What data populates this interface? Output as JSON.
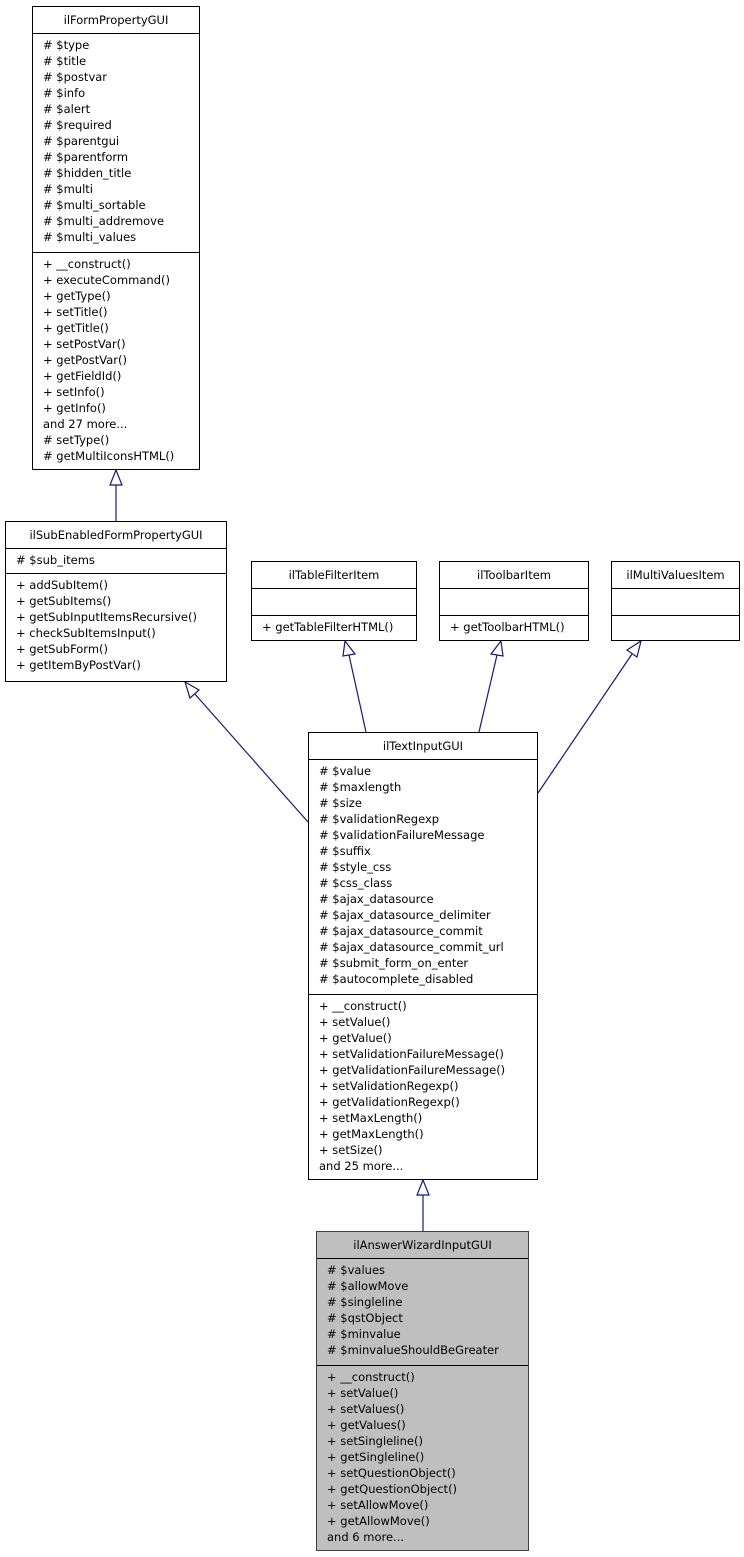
{
  "diagram": {
    "type": "uml-inheritance",
    "classes": {
      "formProperty": {
        "name": "ilFormPropertyGUI",
        "attributes": [
          "# $type",
          "# $title",
          "# $postvar",
          "# $info",
          "# $alert",
          "# $required",
          "# $parentgui",
          "# $parentform",
          "# $hidden_title",
          "# $multi",
          "# $multi_sortable",
          "# $multi_addremove",
          "# $multi_values"
        ],
        "methods": [
          "+ __construct()",
          "+ executeCommand()",
          "+ getType()",
          "+ setTitle()",
          "+ getTitle()",
          "+ setPostVar()",
          "+ getPostVar()",
          "+ getFieldId()",
          "+ setInfo()",
          "+ getInfo()",
          "and 27 more...",
          "# setType()",
          "# getMultiIconsHTML()"
        ]
      },
      "subEnabled": {
        "name": "ilSubEnabledFormPropertyGUI",
        "attributes": [
          "# $sub_items"
        ],
        "methods": [
          "+ addSubItem()",
          "+ getSubItems()",
          "+ getSubInputItemsRecursive()",
          "+ checkSubItemsInput()",
          "+ getSubForm()",
          "+ getItemByPostVar()"
        ]
      },
      "tableFilter": {
        "name": "ilTableFilterItem",
        "attributes": [],
        "methods": [
          "+ getTableFilterHTML()"
        ]
      },
      "toolbar": {
        "name": "ilToolbarItem",
        "attributes": [],
        "methods": [
          "+ getToolbarHTML()"
        ]
      },
      "multiValues": {
        "name": "ilMultiValuesItem",
        "attributes": [],
        "methods": []
      },
      "textInput": {
        "name": "ilTextInputGUI",
        "attributes": [
          "# $value",
          "# $maxlength",
          "# $size",
          "# $validationRegexp",
          "# $validationFailureMessage",
          "# $suffix",
          "# $style_css",
          "# $css_class",
          "# $ajax_datasource",
          "# $ajax_datasource_delimiter",
          "# $ajax_datasource_commit",
          "# $ajax_datasource_commit_url",
          "# $submit_form_on_enter",
          "# $autocomplete_disabled"
        ],
        "methods": [
          "+ __construct()",
          "+ setValue()",
          "+ getValue()",
          "+ setValidationFailureMessage()",
          "+ getValidationFailureMessage()",
          "+ setValidationRegexp()",
          "+ getValidationRegexp()",
          "+ setMaxLength()",
          "+ getMaxLength()",
          "+ setSize()",
          "and 25 more..."
        ]
      },
      "answerWizard": {
        "name": "ilAnswerWizardInputGUI",
        "attributes": [
          "# $values",
          "# $allowMove",
          "# $singleline",
          "# $qstObject",
          "# $minvalue",
          "# $minvalueShouldBeGreater"
        ],
        "methods": [
          "+ __construct()",
          "+ setValue()",
          "+ setValues()",
          "+ getValues()",
          "+ setSingleline()",
          "+ getSingleline()",
          "+ setQuestionObject()",
          "+ getQuestionObject()",
          "+ setAllowMove()",
          "+ getAllowMove()",
          "and 6 more..."
        ]
      }
    },
    "inheritance": [
      {
        "child": "ilSubEnabledFormPropertyGUI",
        "parent": "ilFormPropertyGUI"
      },
      {
        "child": "ilTextInputGUI",
        "parent": "ilSubEnabledFormPropertyGUI"
      },
      {
        "child": "ilTextInputGUI",
        "parent": "ilTableFilterItem"
      },
      {
        "child": "ilTextInputGUI",
        "parent": "ilToolbarItem"
      },
      {
        "child": "ilTextInputGUI",
        "parent": "ilMultiValuesItem"
      },
      {
        "child": "ilAnswerWizardInputGUI",
        "parent": "ilTextInputGUI"
      }
    ],
    "colors": {
      "edge": "#191970",
      "focus_fill": "#bfbfbf",
      "box_fill": "#ffffff"
    }
  }
}
